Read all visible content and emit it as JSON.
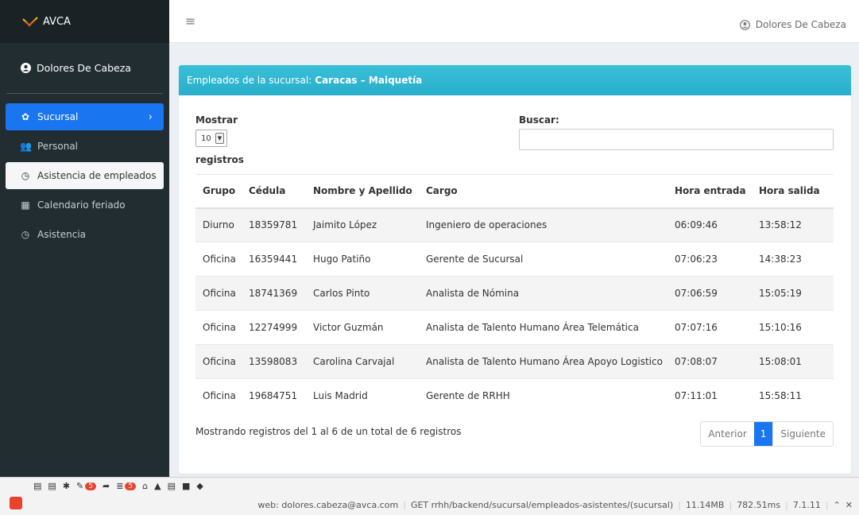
{
  "brand": {
    "name": "AVCA"
  },
  "user": {
    "name": "Dolores De Cabeza"
  },
  "sidebar": {
    "items": [
      {
        "label": "Sucursal",
        "icon": "gears-icon"
      },
      {
        "label": "Personal",
        "icon": "users-icon"
      },
      {
        "label": "Asistencia de empleados",
        "icon": "clock-icon"
      },
      {
        "label": "Calendario feriado",
        "icon": "calendar-icon"
      },
      {
        "label": "Asistencia",
        "icon": "clock-icon"
      }
    ]
  },
  "header": {
    "menu_icon": "≡"
  },
  "box": {
    "title_prefix": "Empleados de la sucursal:",
    "title_branch": "Caracas – Maiquetía"
  },
  "controls": {
    "show_label": "Mostrar",
    "show_value": "10",
    "records_label": "registros",
    "search_label": "Buscar:",
    "search_value": ""
  },
  "table": {
    "headers": [
      "Grupo",
      "Cédula",
      "Nombre y Apellido",
      "Cargo",
      "Hora entrada",
      "Hora salida"
    ],
    "rows": [
      [
        "Diurno",
        "18359781",
        "Jaimito López",
        "Ingeniero de operaciones",
        "06:09:46",
        "13:58:12"
      ],
      [
        "Oficina",
        "16359441",
        "Hugo Patiño",
        "Gerente de Sucursal",
        "07:06:23",
        "14:38:23"
      ],
      [
        "Oficina",
        "18741369",
        "Carlos Pinto",
        "Analista de Nómina",
        "07:06:59",
        "15:05:19"
      ],
      [
        "Oficina",
        "12274999",
        "Victor Guzmán",
        "Analista de Talento Humano Área Telemática",
        "07:07:16",
        "15:10:16"
      ],
      [
        "Oficina",
        "13598083",
        "Carolina Carvajal",
        "Analista de Talento Humano Área Apoyo Logistico",
        "07:08:07",
        "15:08:01"
      ],
      [
        "Oficina",
        "19684751",
        "Luis Madrid",
        "Gerente de RRHH",
        "07:11:01",
        "15:58:11"
      ]
    ]
  },
  "footer": {
    "info": "Mostrando registros del 1 al 6 de un total de 6 registros",
    "prev": "Anterior",
    "page": "1",
    "next": "Siguiente"
  },
  "debug": {
    "badge1": "5",
    "badge2": "5",
    "user": "web: dolores.cabeza@avca.com",
    "route": "GET rrhh/backend/sucursal/empleados-asistentes/(sucursal)",
    "memory": "11.14MB",
    "time": "782.51ms",
    "version": "7.1.11"
  },
  "colors": {
    "accent": "#1976f0",
    "box_header": "#2fb6d0",
    "sidebar": "#222d32",
    "badge": "#e8432e"
  }
}
